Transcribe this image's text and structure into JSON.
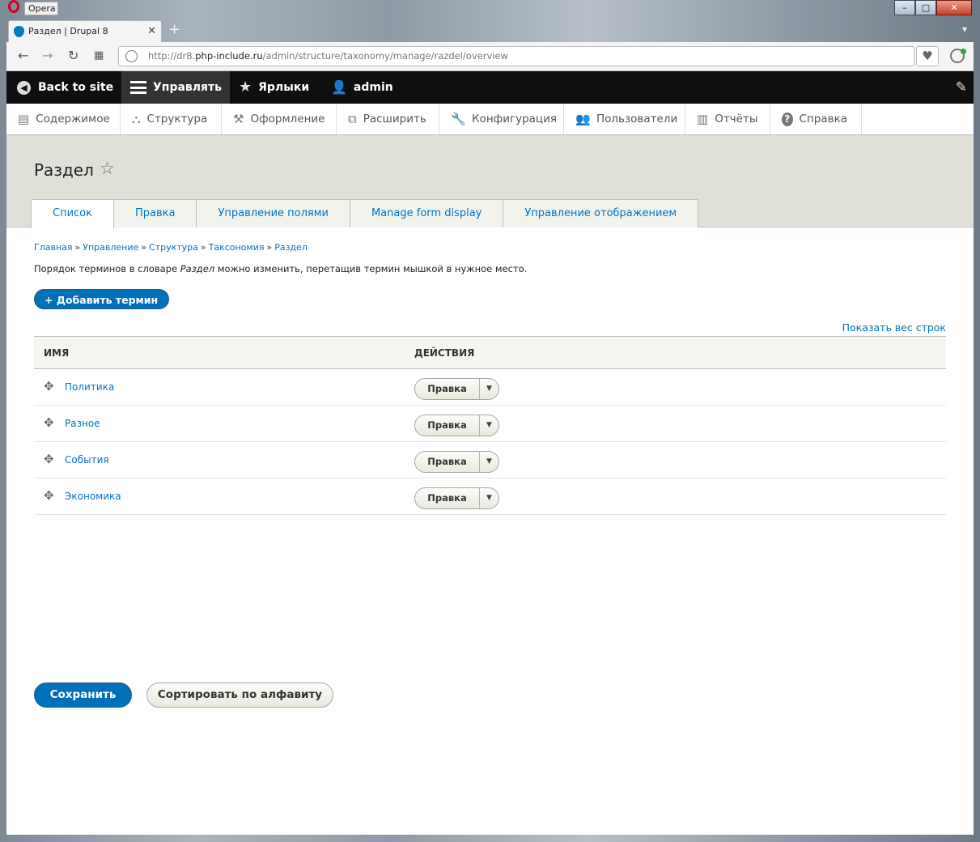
{
  "window": {
    "app_title": "Opera",
    "controls": [
      "–",
      "□",
      "✕"
    ]
  },
  "browser": {
    "tab_title": "Раздел | Drupal 8",
    "tab_close": "✕",
    "new_tab": "+",
    "tab_menu": "▾",
    "address": {
      "prefix": "http://dr8.",
      "host": "php-include.ru",
      "path": "/admin/structure/taxonomy/manage/razdel/overview"
    },
    "heart": "♥"
  },
  "adminbar": {
    "back": "Back to site",
    "manage": "Управлять",
    "shortcuts": "Ярлыки",
    "user": "admin"
  },
  "tray": {
    "items": [
      {
        "label": "Содержимое",
        "icon": "▤"
      },
      {
        "label": "Структура",
        "icon": "⛬"
      },
      {
        "label": "Оформление",
        "icon": "⚒"
      },
      {
        "label": "Расширить",
        "icon": "⧉"
      },
      {
        "label": "Конфигурация",
        "icon": "🔧"
      },
      {
        "label": "Пользователи",
        "icon": "👥"
      },
      {
        "label": "Отчёты",
        "icon": "▥"
      },
      {
        "label": "Справка",
        "icon": "?"
      }
    ]
  },
  "page": {
    "title": "Раздел",
    "tabs": [
      "Список",
      "Правка",
      "Управление полями",
      "Manage form display",
      "Управление отображением"
    ],
    "breadcrumb": [
      "Главная",
      "Управление",
      "Структура",
      "Таксономия",
      "Раздел"
    ],
    "breadcrumb_sep": "»",
    "description_before": "Порядок терминов в словаре ",
    "description_vocab": "Раздел",
    "description_after": " можно изменить, перетащив термин мышкой в нужное место.",
    "add_term": "+ Добавить термин",
    "show_weights": "Показать вес строк",
    "table": {
      "col_name": "ИМЯ",
      "col_actions": "ДЕЙСТВИЯ",
      "rows": [
        {
          "name": "Политика",
          "action": "Правка"
        },
        {
          "name": "Разное",
          "action": "Правка"
        },
        {
          "name": "События",
          "action": "Правка"
        },
        {
          "name": "Экономика",
          "action": "Правка"
        }
      ]
    },
    "save": "Сохранить",
    "sort_alpha": "Сортировать по алфавиту"
  }
}
